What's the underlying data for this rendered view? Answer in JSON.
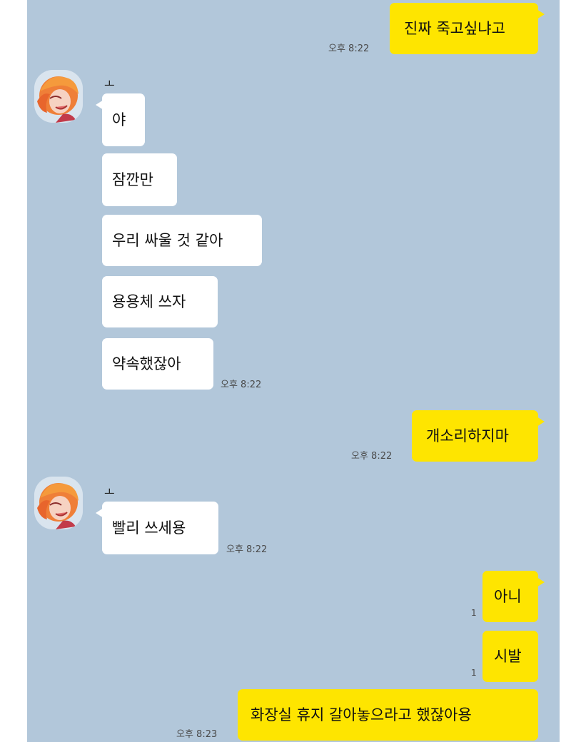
{
  "chat": {
    "messages_top": [
      {
        "text": "진짜 죽고싶냐고",
        "time": "오후 8:22"
      }
    ],
    "friend_block_1": {
      "name": "ㅗ",
      "messages": [
        "야",
        "잠깐만",
        "우리 싸울 것 같아",
        "용용체 쓰자",
        "약속했잖아"
      ],
      "time": "오후 8:22"
    },
    "me_block_2": {
      "text": "개소리하지마",
      "time": "오후 8:22"
    },
    "friend_block_2": {
      "name": "ㅗ",
      "text": "빨리 쓰세용",
      "time": "오후 8:22"
    },
    "me_block_3": {
      "messages": [
        "아니",
        "시발",
        "화장실 휴지 갈아놓으라고 했잖아용"
      ],
      "unread_1": "1",
      "unread_2": "1",
      "time": "오후 8:23"
    }
  },
  "colors": {
    "background": "#b2c7da",
    "my_bubble": "#fee500",
    "friend_bubble": "#ffffff"
  },
  "icons": {
    "avatar": "anime-character-avatar"
  }
}
